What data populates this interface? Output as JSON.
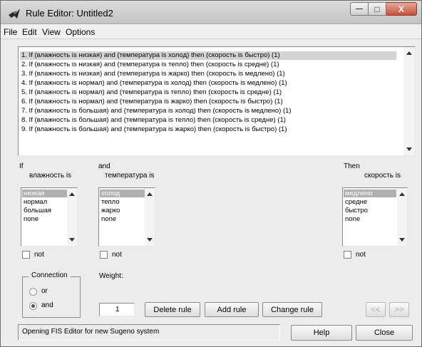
{
  "window": {
    "title": "Rule Editor: Untitled2",
    "minimize": "—",
    "maximize": "□",
    "close": "X"
  },
  "menu": [
    "File",
    "Edit",
    "View",
    "Options"
  ],
  "rules": [
    "1. If (влажность is низкая) and (температура is холод) then (скорость is быстро) (1)",
    "2. If (влажность is низкая) and (температура is тепло) then (скорость is средне) (1)",
    "3. If (влажность is низкая) and (температура is жарко) then (скорость is медлено) (1)",
    "4. If (влажность is нормал) and (температура is холод) then (скорость is медлено) (1)",
    "5. If (влажность is нормал) and (температура is тепло) then (скорость is средне) (1)",
    "6. If (влажность is нормал) and (температура is жарко) then (скорость is быстро) (1)",
    "7. If (влажность is большая) and (температура is холод) then (скорость is медлено) (1)",
    "8. If (влажность is большая) and (температура is тепло) then (скорость is средне) (1)",
    "9. If (влажность is большая) and (температура is жарко) then (скорость is быстро) (1)"
  ],
  "selected_rule_index": 0,
  "inputs": [
    {
      "prefix": "If",
      "variable": "влажность is",
      "options": [
        "низкая",
        "нормал",
        "большая",
        "none"
      ],
      "selected": "низкая",
      "not_label": "not"
    },
    {
      "prefix": "and",
      "variable": "температура is",
      "options": [
        "холод",
        "тепло",
        "жарко",
        "none"
      ],
      "selected": "холод",
      "not_label": "not"
    }
  ],
  "output": {
    "prefix": "Then",
    "variable": "скорость is",
    "options": [
      "медлено",
      "средне",
      "быстро",
      "none"
    ],
    "selected": "медлено",
    "not_label": "not"
  },
  "connection": {
    "title": "Connection",
    "options": [
      "or",
      "and"
    ],
    "selected": "and"
  },
  "weight": {
    "label": "Weight:",
    "value": "1"
  },
  "buttons": {
    "delete_rule": "Delete rule",
    "add_rule": "Add rule",
    "change_rule": "Change rule",
    "prev": "<<",
    "next": ">>",
    "help": "Help",
    "close": "Close"
  },
  "status": "Opening FIS Editor for new Sugeno system",
  "colors": {
    "window_bg": "#ececec",
    "selection_list": "#b0b0b0",
    "selection_rule": "#d4d4d4"
  },
  "icons": {
    "app": "matlab-logo-icon"
  }
}
